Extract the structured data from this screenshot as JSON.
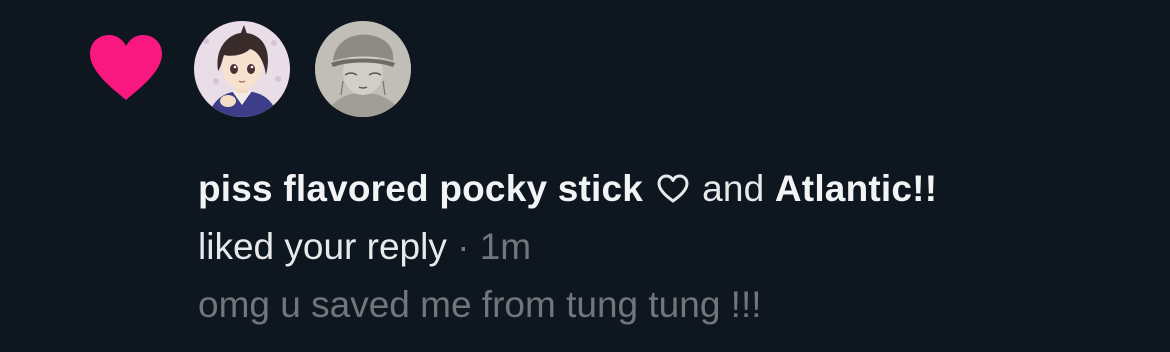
{
  "notification": {
    "type_icon": "heart-icon",
    "accent_color": "#f91880",
    "background_color": "#0e1620",
    "avatars": [
      {
        "user": "piss flavored pocky stick",
        "icon": "anime-avatar"
      },
      {
        "user": "Atlantic!!",
        "icon": "sketch-avatar"
      }
    ],
    "user1": "piss flavored pocky stick",
    "user1_suffix_icon": "heart-outline-icon",
    "conjunction": "and",
    "user2": "Atlantic!!",
    "action": "liked your reply",
    "separator": "·",
    "time": "1m",
    "reply_preview": "omg u saved me from tung tung !!!"
  }
}
